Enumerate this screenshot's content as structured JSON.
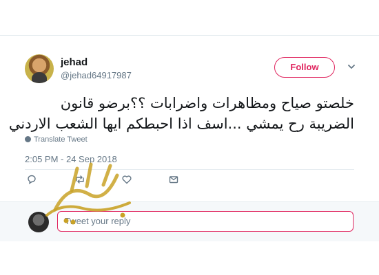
{
  "tweet": {
    "user": {
      "name": "jehad",
      "handle": "@jehad64917987"
    },
    "follow_label": "Follow",
    "text_lines": [
      "خلصتو صياح ومظاهرات واضرابات ؟؟برضو قانون",
      "الضريبة رح يمشي ...اسف اذا احبطكم ايها الشعب الاردني"
    ],
    "translate_label": "Translate Tweet",
    "timestamp": "2:05 PM - 24 Sep 2018",
    "reply": {
      "placeholder": "Tweet your reply"
    }
  },
  "watermark": {
    "text": "الوكيل"
  },
  "colors": {
    "accent": "#e0245e",
    "muted": "#657786",
    "watermark": "#c9a227"
  },
  "icons": [
    "chevron-down-icon",
    "globe-icon",
    "reply-icon",
    "retweet-icon",
    "like-icon",
    "message-icon"
  ]
}
